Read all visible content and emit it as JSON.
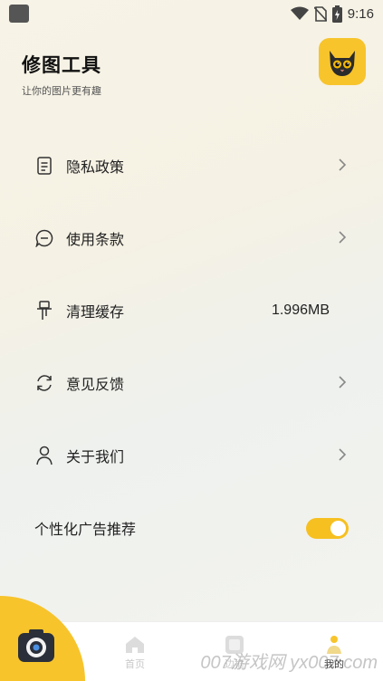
{
  "status_bar": {
    "time": "9:16",
    "icons": [
      "wifi-icon",
      "no-sim-icon",
      "battery-charging-icon"
    ]
  },
  "header": {
    "title": "修图工具",
    "subtitle": "让你的图片更有趣",
    "avatar_icon": "cat-avatar-icon"
  },
  "menu": [
    {
      "label": "隐私政策",
      "icon": "document-icon",
      "has_chevron": true
    },
    {
      "label": "使用条款",
      "icon": "chat-bubble-icon",
      "has_chevron": true
    },
    {
      "label": "清理缓存",
      "icon": "broom-icon",
      "value": "1.996MB"
    },
    {
      "label": "意见反馈",
      "icon": "refresh-icon",
      "has_chevron": true
    },
    {
      "label": "关于我们",
      "icon": "person-icon",
      "has_chevron": true
    }
  ],
  "ad_setting": {
    "label": "个性化广告推荐",
    "enabled": true
  },
  "bottom_nav": {
    "tabs": [
      {
        "label": "首页",
        "icon": "home-icon"
      },
      {
        "label": "边框",
        "icon": "frame-icon"
      },
      {
        "label": "我的",
        "icon": "profile-dot-icon",
        "active": true
      }
    ],
    "camera_icon": "camera-icon"
  },
  "watermark": "007游戏网 yx007.com",
  "colors": {
    "accent": "#f7c42c",
    "toggle_on": "#f6c021",
    "text": "#222222",
    "tab_inactive": "#c8c8c8"
  }
}
